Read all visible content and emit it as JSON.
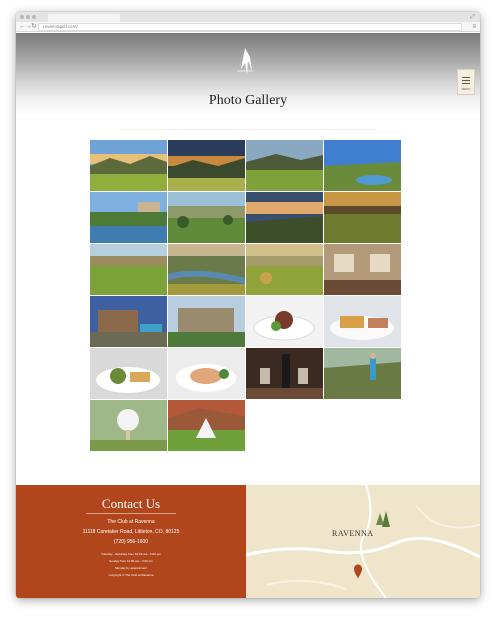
{
  "browser": {
    "url": "ravennagolf.com/",
    "colors": {
      "chrome": "#e4e4e4",
      "addressbar": "#f6f6f6"
    }
  },
  "header": {
    "title": "Photo Gallery",
    "menu_label": "MENU"
  },
  "gallery": {
    "items": [
      {
        "name": "gallery-photo-1",
        "subject": "golf course valley at sunset"
      },
      {
        "name": "gallery-photo-2",
        "subject": "fairway at dusk with mountains"
      },
      {
        "name": "gallery-photo-3",
        "subject": "green fairway with hills"
      },
      {
        "name": "gallery-photo-4",
        "subject": "fairway with pond and blue sky"
      },
      {
        "name": "gallery-photo-5",
        "subject": "clubhouse above pond"
      },
      {
        "name": "gallery-photo-6",
        "subject": "course with homes and trees"
      },
      {
        "name": "gallery-photo-7",
        "subject": "sunset sky over course"
      },
      {
        "name": "gallery-photo-8",
        "subject": "evening light on fairway"
      },
      {
        "name": "gallery-photo-9",
        "subject": "fairway with homes"
      },
      {
        "name": "gallery-photo-10",
        "subject": "creek through course"
      },
      {
        "name": "gallery-photo-11",
        "subject": "course with rock outcrops"
      },
      {
        "name": "gallery-photo-12",
        "subject": "clubhouse interior lounge"
      },
      {
        "name": "gallery-photo-13",
        "subject": "clubhouse with pool"
      },
      {
        "name": "gallery-photo-14",
        "subject": "stone clubhouse exterior"
      },
      {
        "name": "gallery-photo-15",
        "subject": "plated dish with greens"
      },
      {
        "name": "gallery-photo-16",
        "subject": "sandwich plate"
      },
      {
        "name": "gallery-photo-17",
        "subject": "salad and bread plate"
      },
      {
        "name": "gallery-photo-18",
        "subject": "plated fish dish"
      },
      {
        "name": "gallery-photo-19",
        "subject": "wine bottle and glasses"
      },
      {
        "name": "gallery-photo-20",
        "subject": "golfer swinging on course"
      },
      {
        "name": "gallery-photo-21",
        "subject": "golf ball on tee"
      },
      {
        "name": "gallery-photo-22",
        "subject": "pyramid of golf balls"
      }
    ]
  },
  "contact": {
    "heading": "Contact Us",
    "club_name": "The Club at Ravenna",
    "address": "11118 Caretaker Road, Littleton, CO, 80125",
    "phone": "(720) 956-1600",
    "hours_1": "Tuesday - Saturday from 10:00 am - 5:00 pm",
    "hours_2": "Sunday from 11:00 am - 3:00 pm",
    "hours_3": "Monday by appointment",
    "copyright": "Copyright © The Club at Ravenna",
    "colors": {
      "background": "#b1451c",
      "text": "#ffffff"
    }
  },
  "map": {
    "label": "RAVENNA",
    "colors": {
      "land": "#efe5cb",
      "road": "#ffffff",
      "pin": "#b1451c"
    }
  }
}
